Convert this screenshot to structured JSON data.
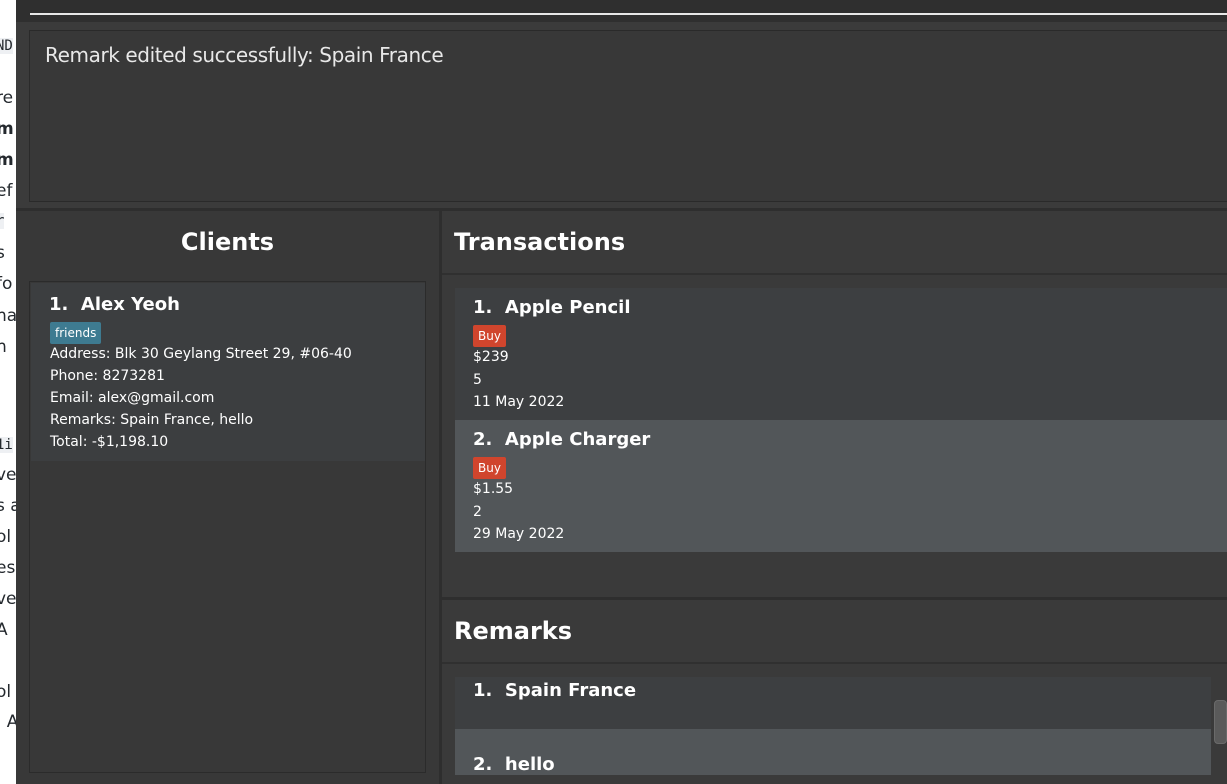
{
  "background_doc": {
    "fragments": [
      "ND",
      "re",
      "m",
      "m",
      "ef",
      "r",
      "s",
      "fo",
      "na",
      "n",
      "1i",
      "ve",
      "s a",
      "ol",
      "esu",
      "ve",
      "A",
      "ol",
      ". A"
    ]
  },
  "result_display": {
    "message": "Remark edited successfully: Spain France"
  },
  "clients": {
    "title": "Clients",
    "items": [
      {
        "index": "1.",
        "name": "Alex Yeoh",
        "tag": "friends",
        "address": "Address: Blk 30 Geylang Street 29, #06-40",
        "phone": "Phone: 8273281",
        "email": "Email: alex@gmail.com",
        "remarks": "Remarks: Spain France, hello",
        "total": "Total: -$1,198.10"
      }
    ]
  },
  "transactions": {
    "title": "Transactions",
    "items": [
      {
        "index": "1.",
        "name": "Apple Pencil",
        "type": "Buy",
        "price": "$239",
        "quantity": "5",
        "date": "11 May 2022"
      },
      {
        "index": "2.",
        "name": "Apple Charger",
        "type": "Buy",
        "price": "$1.55",
        "quantity": "2",
        "date": "29 May 2022"
      }
    ]
  },
  "remarks": {
    "title": "Remarks",
    "items": [
      {
        "index": "1.",
        "text": "Spain France"
      },
      {
        "index": "2.",
        "text": "hello"
      }
    ]
  },
  "colors": {
    "panel_bg": "#3a3a3a",
    "card_bg": "#3d3f41",
    "selected_card_bg": "#525659",
    "tag_friends": "#3e7b91",
    "tag_buy": "#d0452d"
  }
}
